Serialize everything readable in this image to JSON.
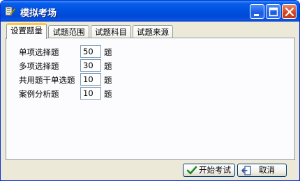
{
  "window": {
    "title": "模拟考场"
  },
  "tabs": [
    {
      "label": "设置题量",
      "active": true
    },
    {
      "label": "试题范围",
      "active": false
    },
    {
      "label": "试题科目",
      "active": false
    },
    {
      "label": "试题来源",
      "active": false
    }
  ],
  "settings": [
    {
      "label": "单项选择题",
      "value": "50",
      "unit": "题"
    },
    {
      "label": "多项选择题",
      "value": "30",
      "unit": "题"
    },
    {
      "label": "共用题干单选题",
      "value": "10",
      "unit": "题"
    },
    {
      "label": "案例分析题",
      "value": "10",
      "unit": "题"
    }
  ],
  "buttons": {
    "start": "开始考试",
    "cancel": "取消"
  },
  "colors": {
    "titlebar": "#0054e3",
    "tab_highlight": "#ffc83c",
    "close_button": "#d1441f",
    "panel_bg": "#ece9d8"
  }
}
